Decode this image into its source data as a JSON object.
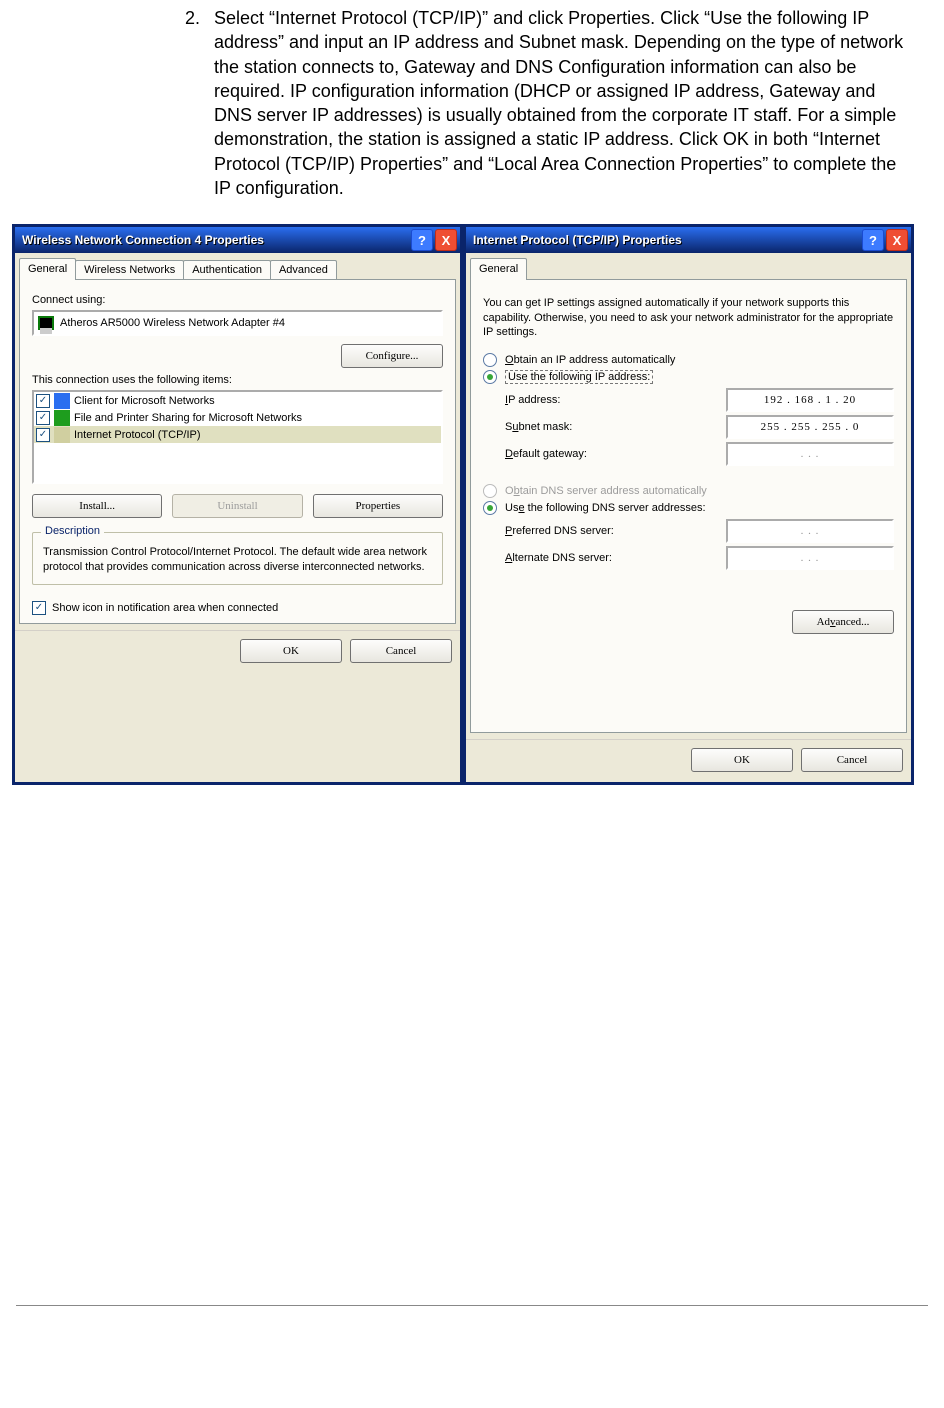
{
  "body": {
    "number": "2.",
    "text": "Select “Internet Protocol (TCP/IP)” and click Properties. Click “Use the following IP address” and input an IP address and Subnet mask. Depending on the type of network the station connects to, Gateway and DNS Configuration information can also be required. IP configuration information (DHCP or assigned IP address, Gateway and DNS server IP addresses) is usually obtained from the corporate IT staff. For a simple demonstration, the station is assigned a static IP address. Click OK in both “Internet Protocol (TCP/IP) Properties” and “Local Area Connection Properties” to complete the IP configuration."
  },
  "left": {
    "title": "Wireless Network Connection 4 Properties",
    "tabs": [
      "General",
      "Wireless Networks",
      "Authentication",
      "Advanced"
    ],
    "connect_label": "Connect using:",
    "adapter": "Atheros AR5000 Wireless Network Adapter #4",
    "configure": "Configure...",
    "items_label": "This connection uses the following items:",
    "items": [
      "Client for Microsoft Networks",
      "File and Printer Sharing for Microsoft Networks",
      "Internet Protocol (TCP/IP)"
    ],
    "install": "Install...",
    "uninstall": "Uninstall",
    "properties": "Properties",
    "desc_title": "Description",
    "desc": "Transmission Control Protocol/Internet Protocol. The default wide area network protocol that provides communication across diverse interconnected networks.",
    "show_icon": "Show icon in notification area when connected",
    "ok": "OK",
    "cancel": "Cancel"
  },
  "right": {
    "title": "Internet Protocol (TCP/IP) Properties",
    "tab": "General",
    "intro": "You can get IP settings assigned automatically if your network supports this capability. Otherwise, you need to ask your network administrator for the appropriate IP settings.",
    "obtain_ip": "Obtain an IP address automatically",
    "use_ip": "Use the following IP address:",
    "ip_label": "IP address:",
    "ip_value": "192 . 168 .   1   .  20",
    "subnet_label": "Subnet mask:",
    "subnet_value": "255 . 255 . 255 .   0",
    "gateway_label": "Default gateway:",
    "empty_ip": ".       .       .",
    "obtain_dns": "Obtain DNS server address automatically",
    "use_dns": "Use the following DNS server addresses:",
    "pref_dns": "Preferred DNS server:",
    "alt_dns": "Alternate DNS server:",
    "advanced": "Advanced...",
    "ok": "OK",
    "cancel": "Cancel"
  },
  "help_glyph": "?",
  "close_glyph": "X"
}
